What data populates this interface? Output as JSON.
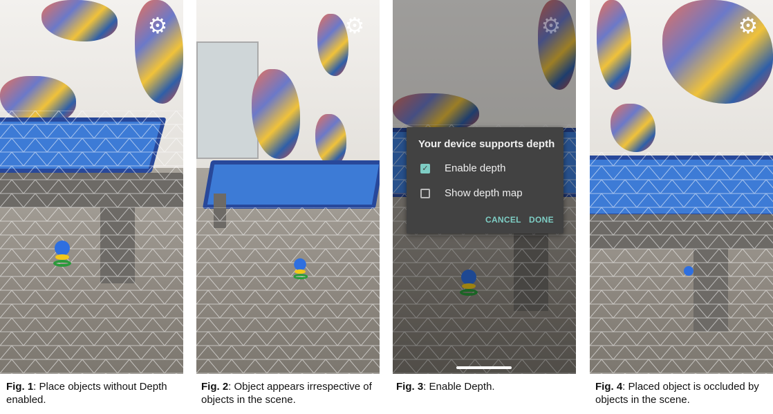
{
  "panels": [
    {
      "caption_bold": "Fig. 1",
      "caption_text": ": Place objects without Depth enabled.",
      "icon": "gear-icon"
    },
    {
      "caption_bold": "Fig. 2",
      "caption_text": ": Object appears irrespective of objects in the scene.",
      "icon": "gear-icon"
    },
    {
      "caption_bold": "Fig. 3",
      "caption_text": ": Enable Depth.",
      "icon": "gear-icon"
    },
    {
      "caption_bold": "Fig. 4",
      "caption_text": ": Placed object is occluded by objects in the scene.",
      "icon": "gear-icon"
    }
  ],
  "dialog": {
    "title": "Your device supports depth",
    "options": [
      {
        "label": "Enable depth",
        "checked": true
      },
      {
        "label": "Show depth map",
        "checked": false
      }
    ],
    "cancel": "CANCEL",
    "done": "DONE"
  },
  "colors": {
    "accent": "#7ecdc4",
    "dialog_bg": "#424242",
    "table_felt": "#3d7bd6"
  }
}
